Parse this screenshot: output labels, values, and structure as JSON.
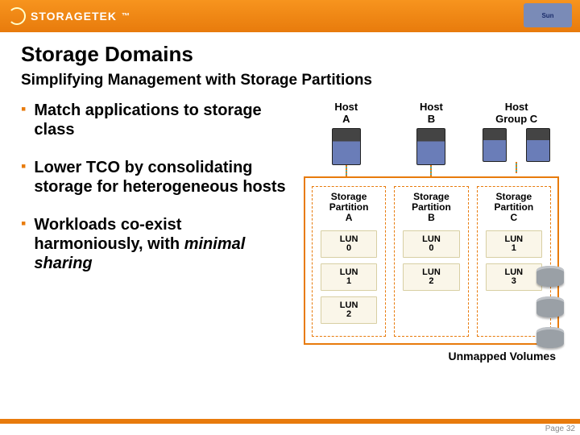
{
  "brand": "STORAGETEK",
  "sunText": "Sun",
  "title": "Storage Domains",
  "subtitle": "Simplifying Management with Storage Partitions",
  "bullets": [
    "Match applications to storage class",
    "Lower TCO by consolidating storage for heterogeneous hosts",
    "Workloads co-exist harmoniously, with <em>minimal sharing</em>"
  ],
  "hosts": {
    "a": {
      "label1": "Host",
      "label2": "A"
    },
    "b": {
      "label1": "Host",
      "label2": "B"
    },
    "c": {
      "label1": "Host",
      "label2": "Group C"
    }
  },
  "partitions": {
    "a": {
      "l1": "Storage",
      "l2": "Partition",
      "l3": "A",
      "luns": [
        "LUN\n0",
        "LUN\n1",
        "LUN\n2"
      ]
    },
    "b": {
      "l1": "Storage",
      "l2": "Partition",
      "l3": "B",
      "luns": [
        "LUN\n0",
        "LUN\n2"
      ]
    },
    "c": {
      "l1": "Storage",
      "l2": "Partition",
      "l3": "C",
      "luns": [
        "LUN\n1",
        "LUN\n3"
      ]
    }
  },
  "unmapped": "Unmapped Volumes",
  "page": "Page 32"
}
